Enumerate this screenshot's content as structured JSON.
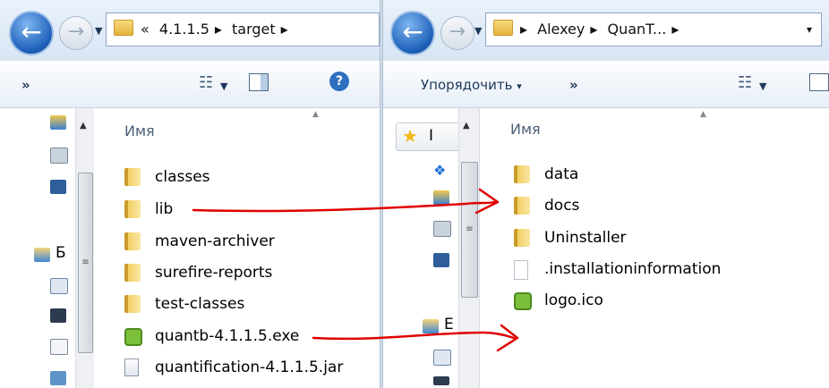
{
  "left_window": {
    "address": {
      "overflow": "«",
      "segments": [
        "4.1.1.5",
        "target"
      ],
      "trailing": "▸"
    },
    "toolbar": {
      "more": "»",
      "views_icon": "views-icon",
      "pane_icon": "preview-pane-icon",
      "help_icon": "help-icon"
    },
    "column_header": "Имя",
    "items": [
      {
        "name": "classes",
        "type": "folder"
      },
      {
        "name": "lib",
        "type": "folder"
      },
      {
        "name": "maven-archiver",
        "type": "folder"
      },
      {
        "name": "surefire-reports",
        "type": "folder"
      },
      {
        "name": "test-classes",
        "type": "folder"
      },
      {
        "name": "quantb-4.1.1.5.exe",
        "type": "exe"
      },
      {
        "name": "quantification-4.1.1.5.jar",
        "type": "jar"
      }
    ],
    "nav_partial_label": "Б"
  },
  "right_window": {
    "address": {
      "segments": [
        "Alexey",
        "QuanT..."
      ],
      "trailing": "▸",
      "caret": "▾"
    },
    "toolbar": {
      "organize": "Упорядочить",
      "organize_caret": "▾",
      "more": "»",
      "views_icon": "views-icon"
    },
    "column_header": "Имя",
    "items": [
      {
        "name": "data",
        "type": "folder"
      },
      {
        "name": "docs",
        "type": "folder"
      },
      {
        "name": "Uninstaller",
        "type": "folder"
      },
      {
        "name": ".installationinformation",
        "type": "file"
      },
      {
        "name": "logo.ico",
        "type": "exe"
      }
    ],
    "nav_partial_labels": [
      "I",
      "E"
    ]
  },
  "annotation_color": "#e00000"
}
